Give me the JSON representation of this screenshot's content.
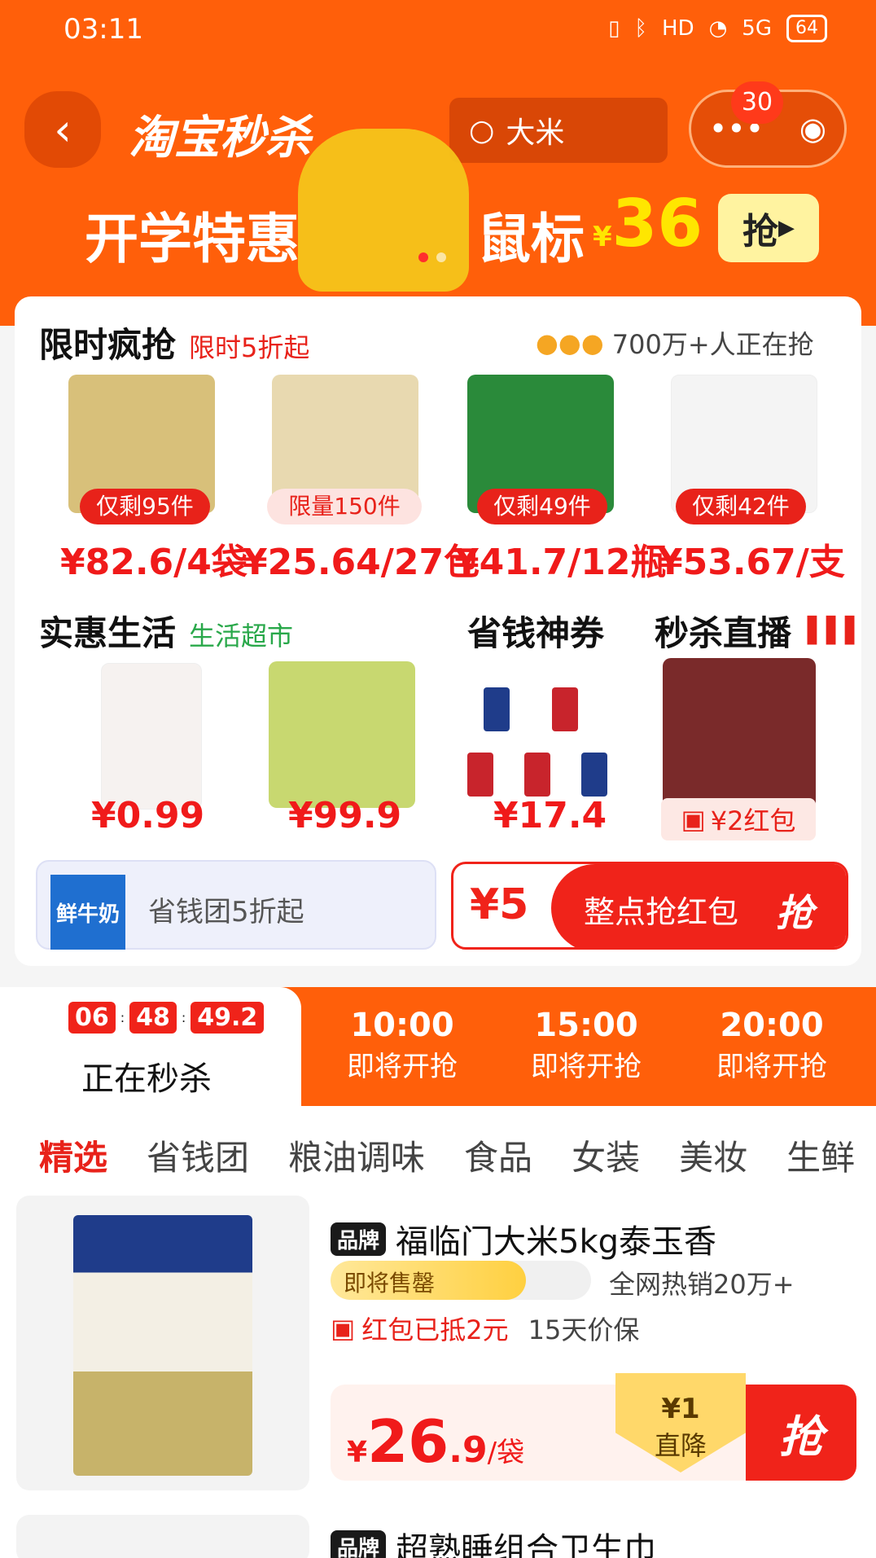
{
  "status": {
    "time": "03:11",
    "network": "5G",
    "hd": "HD",
    "battery": "64"
  },
  "header": {
    "logo": "淘宝秒杀",
    "search_text": "大米",
    "notification_count": "30"
  },
  "banner": {
    "text_left": "开学特惠",
    "text_mid": "鼠标",
    "currency": "¥",
    "price": "36",
    "button": "抢"
  },
  "flash": {
    "title": "限时疯抢",
    "subtitle": "限时5折起",
    "buyers": "700万+人正在抢",
    "items": [
      {
        "tag": "仅剩95件",
        "price": "¥82.6/4袋"
      },
      {
        "tag": "限量150件",
        "price": "¥25.64/27包"
      },
      {
        "tag": "仅剩49件",
        "price": "¥41.7/12瓶"
      },
      {
        "tag": "仅剩42件",
        "price": "¥53.67/支"
      }
    ]
  },
  "life": {
    "title": "实惠生活",
    "subtitle": "生活超市",
    "price1": "¥0.99",
    "price2": "¥99.9"
  },
  "coupon": {
    "title": "省钱神券",
    "price": "¥17.4"
  },
  "live": {
    "title": "秒杀直播",
    "redpack": "¥2红包"
  },
  "group": {
    "milk": "鲜牛奶",
    "label": "省钱团5折起"
  },
  "hourly": {
    "amount": "¥5",
    "label": "整点抢红包",
    "button": "抢"
  },
  "timeline": {
    "active": {
      "h": "06",
      "m": "48",
      "s": "49.2",
      "label": "正在秒杀"
    },
    "slots": [
      {
        "time": "10:00",
        "label": "即将开抢"
      },
      {
        "time": "15:00",
        "label": "即将开抢"
      },
      {
        "time": "20:00",
        "label": "即将开抢"
      }
    ]
  },
  "categories": [
    "精选",
    "省钱团",
    "粮油调味",
    "食品",
    "女装",
    "美妆",
    "生鲜"
  ],
  "product": {
    "brand": "品牌",
    "name": "福临门大米5kg泰玉香",
    "stock_label": "即将售罄",
    "stock_level": 0.75,
    "hot": "全网热销20万+",
    "coupon": "红包已抵2元",
    "guarantee": "15天价保",
    "currency": "¥",
    "price_int": "26",
    "price_dec": ".9",
    "unit": "/袋",
    "drop_amount": "¥1",
    "drop_label": "直降",
    "buy": "抢"
  },
  "product2": {
    "brand": "品牌",
    "name": "超熟睡组合卫生巾"
  },
  "colors": {
    "brand": "#ff5f0a",
    "red": "#f01a1a"
  }
}
